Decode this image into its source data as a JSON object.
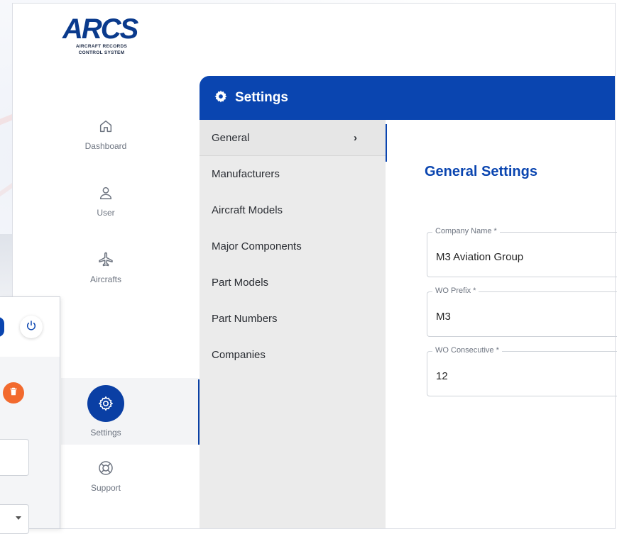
{
  "app": {
    "logo_text": "ARCS",
    "logo_subtitle_line1": "Aircraft Records",
    "logo_subtitle_line2": "Control System"
  },
  "nav": {
    "items": [
      {
        "label": "Dashboard",
        "icon": "home-icon"
      },
      {
        "label": "User",
        "icon": "user-icon"
      },
      {
        "label": "Aircrafts",
        "icon": "airplane-icon"
      },
      {
        "label": "Settings",
        "icon": "gear-icon",
        "active": true
      },
      {
        "label": "Support",
        "icon": "lifebuoy-icon"
      }
    ]
  },
  "settings": {
    "header_title": "Settings",
    "menu": [
      {
        "label": "General",
        "active": true
      },
      {
        "label": "Manufacturers"
      },
      {
        "label": "Aircraft Models"
      },
      {
        "label": "Major Components"
      },
      {
        "label": "Part Models"
      },
      {
        "label": "Part Numbers"
      },
      {
        "label": "Companies"
      }
    ],
    "general": {
      "title": "General Settings",
      "fields": [
        {
          "label": "Company Name *",
          "value": "M3 Aviation Group"
        },
        {
          "label": "WO Prefix *",
          "value": "M3"
        },
        {
          "label": "WO Consecutive *",
          "value": "12"
        }
      ]
    }
  },
  "colors": {
    "primary": "#0a45b0",
    "nav_active": "#0a3fa4",
    "delete": "#f26a2e",
    "menu_bg": "#ebebeb"
  }
}
